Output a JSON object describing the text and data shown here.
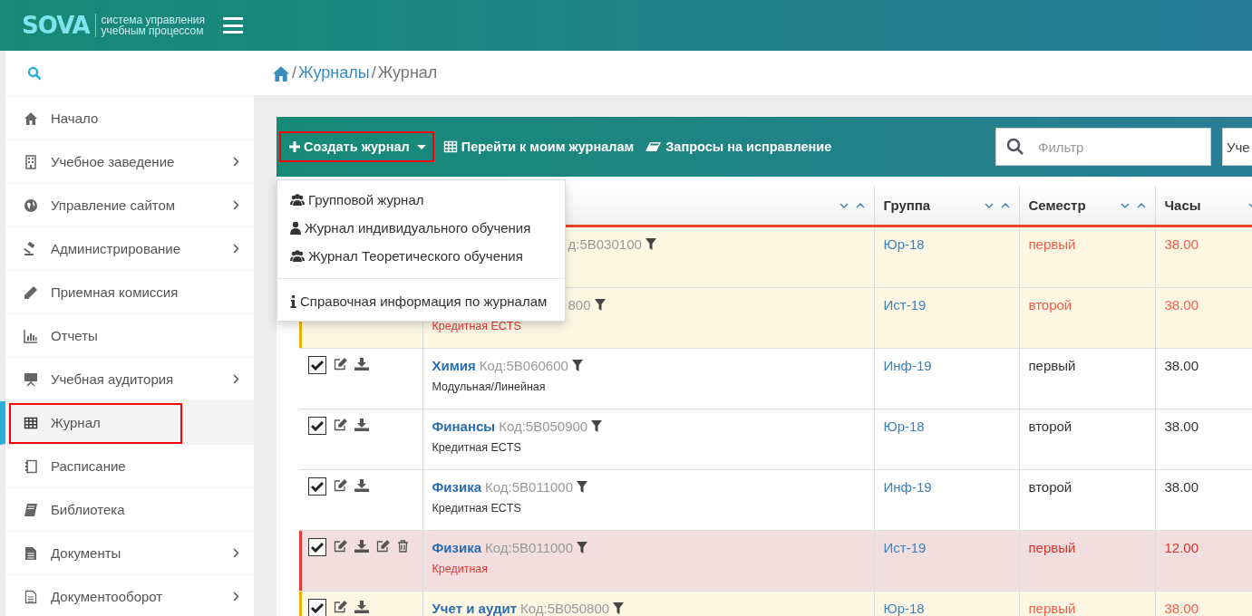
{
  "header": {
    "logo": "SOVA",
    "tagline": [
      "система управления",
      "учебным процессом"
    ]
  },
  "sidebar": {
    "items": [
      {
        "label": "Начало",
        "submenu": false,
        "selected": false,
        "highlighted": false
      },
      {
        "label": "Учебное заведение",
        "submenu": true,
        "selected": false,
        "highlighted": false
      },
      {
        "label": "Управление сайтом",
        "submenu": true,
        "selected": false,
        "highlighted": false
      },
      {
        "label": "Администрирование",
        "submenu": true,
        "selected": false,
        "highlighted": false
      },
      {
        "label": "Приемная комиссия",
        "submenu": false,
        "selected": false,
        "highlighted": false
      },
      {
        "label": "Отчеты",
        "submenu": false,
        "selected": false,
        "highlighted": false
      },
      {
        "label": "Учебная аудитория",
        "submenu": true,
        "selected": false,
        "highlighted": false
      },
      {
        "label": "Журнал",
        "submenu": false,
        "selected": true,
        "highlighted": true
      },
      {
        "label": "Расписание",
        "submenu": false,
        "selected": false,
        "highlighted": false
      },
      {
        "label": "Библиотека",
        "submenu": false,
        "selected": false,
        "highlighted": false
      },
      {
        "label": "Документы",
        "submenu": true,
        "selected": false,
        "highlighted": false
      },
      {
        "label": "Документооборот",
        "submenu": true,
        "selected": false,
        "highlighted": false
      }
    ]
  },
  "breadcrumb": {
    "separator": "/",
    "items": [
      {
        "label": "Журналы",
        "link": true
      },
      {
        "label": "Журнал",
        "link": false
      }
    ]
  },
  "toolbar": {
    "buttons": [
      {
        "label": "Создать журнал",
        "caret": true,
        "highlighted": true
      },
      {
        "label": "Перейти к моим журналам",
        "caret": false,
        "highlighted": false
      },
      {
        "label": "Запросы на исправление",
        "caret": false,
        "highlighted": false
      }
    ],
    "filter": {
      "placeholder": "Фильтр"
    },
    "select": {
      "value": "Уче"
    }
  },
  "dropdown": {
    "items": [
      {
        "label": "Групповой журнал",
        "divider_before": false
      },
      {
        "label": "Журнал индивидуального обучения",
        "divider_before": false
      },
      {
        "label": "Журнал Теоретического обучения",
        "divider_before": false
      },
      {
        "label": "Справочная информация по журналам",
        "divider_before": true
      }
    ]
  },
  "table": {
    "columns": [
      {
        "sortable": true
      },
      {
        "label": "Группа",
        "sortable": true
      },
      {
        "label": "Семестр",
        "sortable": true
      },
      {
        "label": "Часы",
        "sortable": true
      }
    ],
    "rows": [
      {
        "kind": "warning",
        "code": "д:5B030100",
        "group": "Юр-18",
        "semester": "первый",
        "hours": "38.00"
      },
      {
        "kind": "warning",
        "code": "800",
        "type": "Кредитная ECTS",
        "group": "Ист-19",
        "semester": "второй",
        "hours": "38.00"
      },
      {
        "kind": "normal",
        "checked": true,
        "can_delete": false,
        "name": "Химия",
        "code": "Код:5B060600",
        "type": "Модульная/Линейная",
        "group": "Инф-19",
        "semester": "первый",
        "hours": "38.00"
      },
      {
        "kind": "normal",
        "checked": true,
        "can_delete": false,
        "name": "Финансы",
        "code": "Код:5B050900",
        "type": "Кредитная ECTS",
        "group": "Юр-18",
        "semester": "второй",
        "hours": "38.00"
      },
      {
        "kind": "normal",
        "checked": true,
        "can_delete": false,
        "name": "Физика",
        "code": "Код:5B011000",
        "type": "Кредитная ECTS",
        "group": "Инф-19",
        "semester": "второй",
        "hours": "38.00"
      },
      {
        "kind": "danger",
        "checked": true,
        "can_delete": true,
        "name": "Физика",
        "code": "Код:5B011000",
        "type": "Кредитная",
        "group": "Ист-19",
        "semester": "первый",
        "hours": "12.00"
      },
      {
        "kind": "warning",
        "checked": true,
        "can_delete": false,
        "name": "Учет и аудит",
        "code": "Код:5B050800",
        "group": "Юр-18",
        "semester": "первый",
        "hours": "38.00"
      }
    ]
  }
}
